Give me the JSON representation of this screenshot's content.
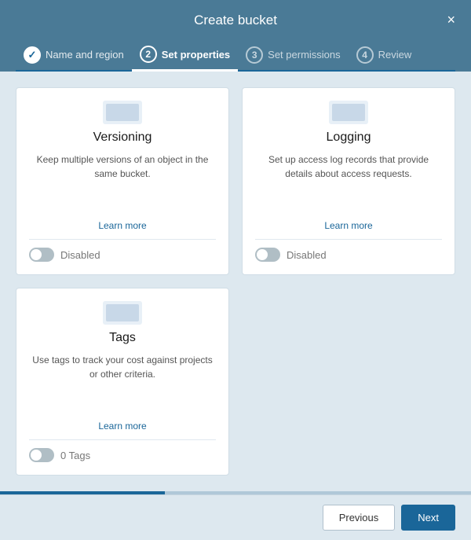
{
  "modal": {
    "title": "Create bucket",
    "close_label": "×"
  },
  "steps": [
    {
      "number": "✓",
      "label": "Name and region",
      "state": "completed"
    },
    {
      "number": "2",
      "label": "Set properties",
      "state": "active"
    },
    {
      "number": "3",
      "label": "Set permissions",
      "state": "default"
    },
    {
      "number": "4",
      "label": "Review",
      "state": "default"
    }
  ],
  "cards": [
    {
      "title": "Versioning",
      "description": "Keep multiple versions of an object in the same bucket.",
      "learn_more": "Learn more",
      "toggle_label": "Disabled",
      "type": "toggle"
    },
    {
      "title": "Logging",
      "description": "Set up access log records that provide details about access requests.",
      "learn_more": "Learn more",
      "toggle_label": "Disabled",
      "type": "toggle"
    },
    {
      "title": "Tags",
      "description": "Use tags to track your cost against projects or other criteria.",
      "learn_more": "Learn more",
      "toggle_label": "0 Tags",
      "type": "tags"
    }
  ],
  "footer": {
    "previous_label": "Previous",
    "next_label": "Next"
  }
}
